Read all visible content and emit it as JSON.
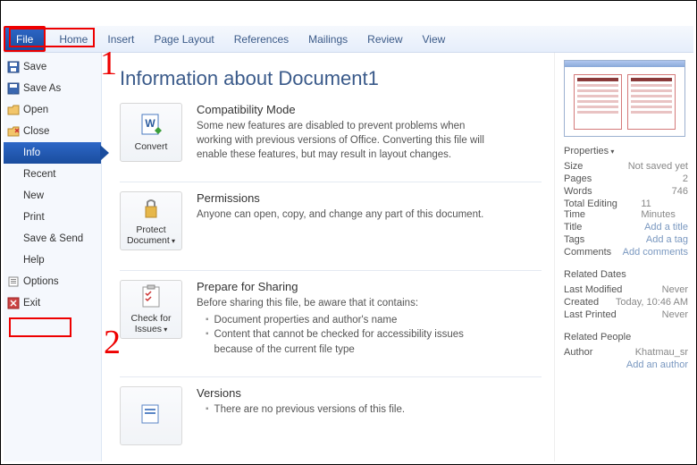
{
  "ribbon": {
    "file": "File",
    "tabs": [
      "Home",
      "Insert",
      "Page Layout",
      "References",
      "Mailings",
      "Review",
      "View"
    ]
  },
  "sidebar": {
    "items": [
      {
        "label": "Save"
      },
      {
        "label": "Save As"
      },
      {
        "label": "Open"
      },
      {
        "label": "Close"
      },
      {
        "label": "Info"
      },
      {
        "label": "Recent"
      },
      {
        "label": "New"
      },
      {
        "label": "Print"
      },
      {
        "label": "Save & Send"
      },
      {
        "label": "Help"
      },
      {
        "label": "Options"
      },
      {
        "label": "Exit"
      }
    ]
  },
  "annotations": {
    "num1": "1",
    "num2": "2"
  },
  "title": "Information about Document1",
  "sections": {
    "compat": {
      "btn": "Convert",
      "head": "Compatibility Mode",
      "body": "Some new features are disabled to prevent problems when working with previous versions of Office. Converting this file will enable these features, but may result in layout changes."
    },
    "perms": {
      "btn": "Protect Document",
      "head": "Permissions",
      "body": "Anyone can open, copy, and change any part of this document."
    },
    "share": {
      "btn": "Check for Issues",
      "head": "Prepare for Sharing",
      "intro": "Before sharing this file, be aware that it contains:",
      "li1": "Document properties and author's name",
      "li2": "Content that cannot be checked for accessibility issues because of the current file type"
    },
    "versions": {
      "head": "Versions",
      "body": "There are no previous versions of this file."
    }
  },
  "props": {
    "header": "Properties",
    "rows": [
      {
        "k": "Size",
        "v": "Not saved yet"
      },
      {
        "k": "Pages",
        "v": "2"
      },
      {
        "k": "Words",
        "v": "746"
      },
      {
        "k": "Total Editing Time",
        "v": "11 Minutes"
      },
      {
        "k": "Title",
        "v": "Add a title",
        "link": true
      },
      {
        "k": "Tags",
        "v": "Add a tag",
        "link": true
      },
      {
        "k": "Comments",
        "v": "Add comments",
        "link": true
      }
    ],
    "dates": {
      "h": "Related Dates",
      "rows": [
        {
          "k": "Last Modified",
          "v": "Never"
        },
        {
          "k": "Created",
          "v": "Today, 10:46 AM"
        },
        {
          "k": "Last Printed",
          "v": "Never"
        }
      ]
    },
    "people": {
      "h": "Related People",
      "rows": [
        {
          "k": "Author",
          "v": "Khatmau_sr"
        },
        {
          "k": "",
          "v": "Add an author",
          "link": true
        }
      ]
    }
  }
}
